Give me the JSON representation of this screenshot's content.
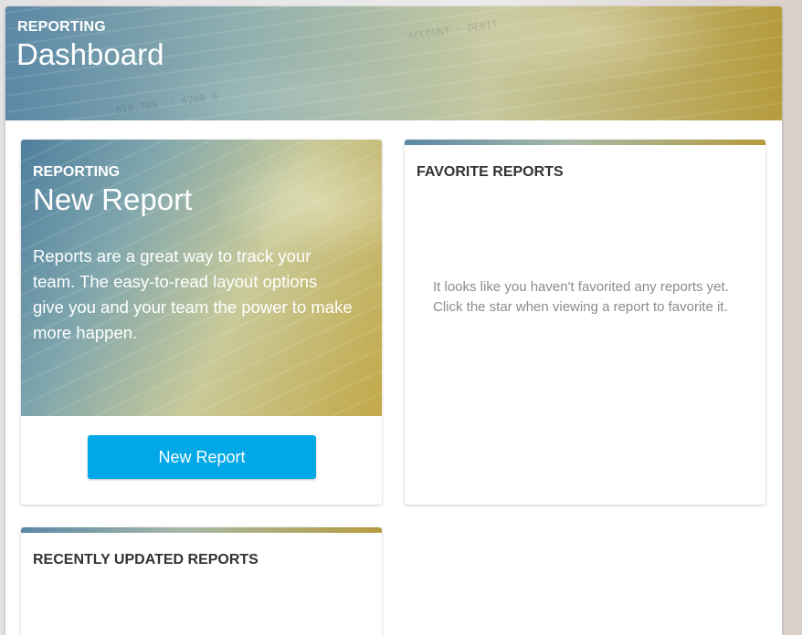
{
  "header": {
    "kicker": "REPORTING",
    "title": "Dashboard"
  },
  "new_report_card": {
    "kicker": "REPORTING",
    "title": "New Report",
    "description": "Reports are a great way to track your team. The easy-to-read layout options give you and your team the power to make more happen.",
    "button_label": "New Report"
  },
  "favorites_card": {
    "heading": "FAVORITE REPORTS",
    "empty_message": "It looks like you haven't favorited any reports yet. Click the star when viewing a report to favorite it."
  },
  "recent_card": {
    "heading": "RECENTLY UPDATED REPORTS"
  },
  "colors": {
    "accent_button": "#00a8e8",
    "gradient_blue": "#5b88a6",
    "gradient_gold": "#b69b3d"
  }
}
